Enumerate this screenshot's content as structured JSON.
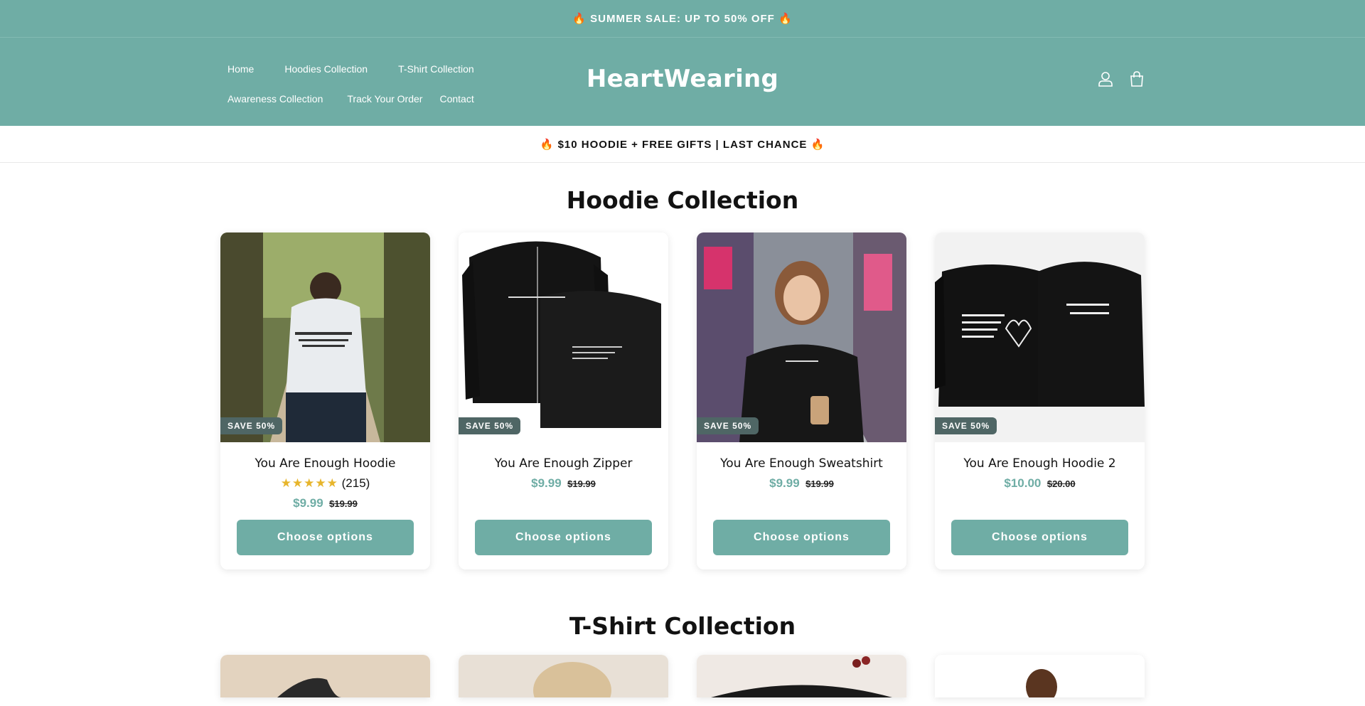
{
  "announcement": "🔥 SUMMER SALE: UP TO 50% OFF 🔥",
  "nav": {
    "row1": [
      "Home",
      "Hoodies Collection",
      "T-Shirt Collection"
    ],
    "row2": [
      "Awareness Collection",
      "Track Your Order",
      "Contact"
    ]
  },
  "brand": "HeartWearing",
  "header_icons": [
    "account-icon",
    "cart-icon"
  ],
  "promo": "🔥 $10 HOODIE + FREE GIFTS | LAST CHANCE 🔥",
  "hoodie_section": {
    "title": "Hoodie Collection",
    "products": [
      {
        "badge": "SAVE 50%",
        "name": "You Are Enough Hoodie",
        "stars": "★★★★★",
        "reviews": "(215)",
        "price": "$9.99",
        "compare": "$19.99",
        "button": "Choose options"
      },
      {
        "badge": "SAVE 50%",
        "name": "You Are Enough Zipper",
        "price": "$9.99",
        "compare": "$19.99",
        "button": "Choose options"
      },
      {
        "badge": "SAVE 50%",
        "name": "You Are Enough Sweatshirt",
        "price": "$9.99",
        "compare": "$19.99",
        "button": "Choose options"
      },
      {
        "badge": "SAVE 50%",
        "name": "You Are Enough Hoodie 2",
        "price": "$10.00",
        "compare": "$20.00",
        "button": "Choose options"
      }
    ]
  },
  "tshirt_section": {
    "title": "T-Shirt Collection"
  },
  "colors": {
    "accent": "#6fada5",
    "badge": "#4f6665",
    "star": "#e7b52c"
  }
}
